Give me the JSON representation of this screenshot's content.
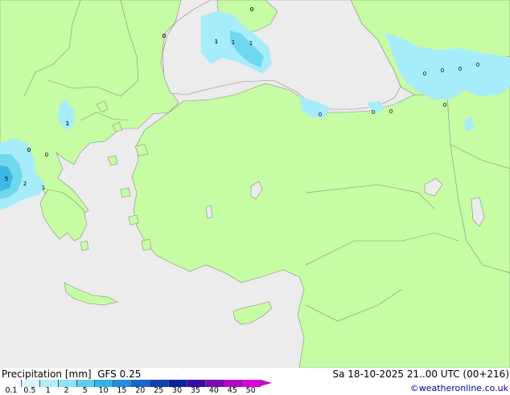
{
  "map": {
    "colors": {
      "sea": "#ececec",
      "land": "#c6fca3",
      "precip_light": "#a7ecfb",
      "precip_mid": "#70d8ee",
      "precip_heavy": "#3bb8e6"
    },
    "value_labels": [
      "0",
      "0",
      "0",
      "0",
      "0",
      "0",
      "0",
      "0",
      "0",
      "0",
      "0",
      "0",
      "0",
      "0",
      "0",
      "1",
      "1",
      "1",
      "1",
      "1",
      "1",
      "2",
      "5",
      "1"
    ]
  },
  "footer": {
    "title": "Precipitation [mm]  GFS 0.25",
    "datetime": "Sa 18-10-2025 21..00 UTC (00+216)",
    "credit": "©weatheronline.co.uk"
  },
  "legend": {
    "ticks": [
      "0.1",
      "0.5",
      "1",
      "2",
      "5",
      "10",
      "15",
      "20",
      "25",
      "30",
      "35",
      "40",
      "45",
      "50"
    ],
    "colors": [
      "#ffffff",
      "#d9f6fe",
      "#b4ecfb",
      "#8ee2f7",
      "#5dcdef",
      "#2fb4e6",
      "#1d8ee0",
      "#1565cc",
      "#0e3fb4",
      "#0a219c",
      "#3a0aa8",
      "#7a08b4",
      "#b406c4",
      "#dc00dc"
    ]
  }
}
